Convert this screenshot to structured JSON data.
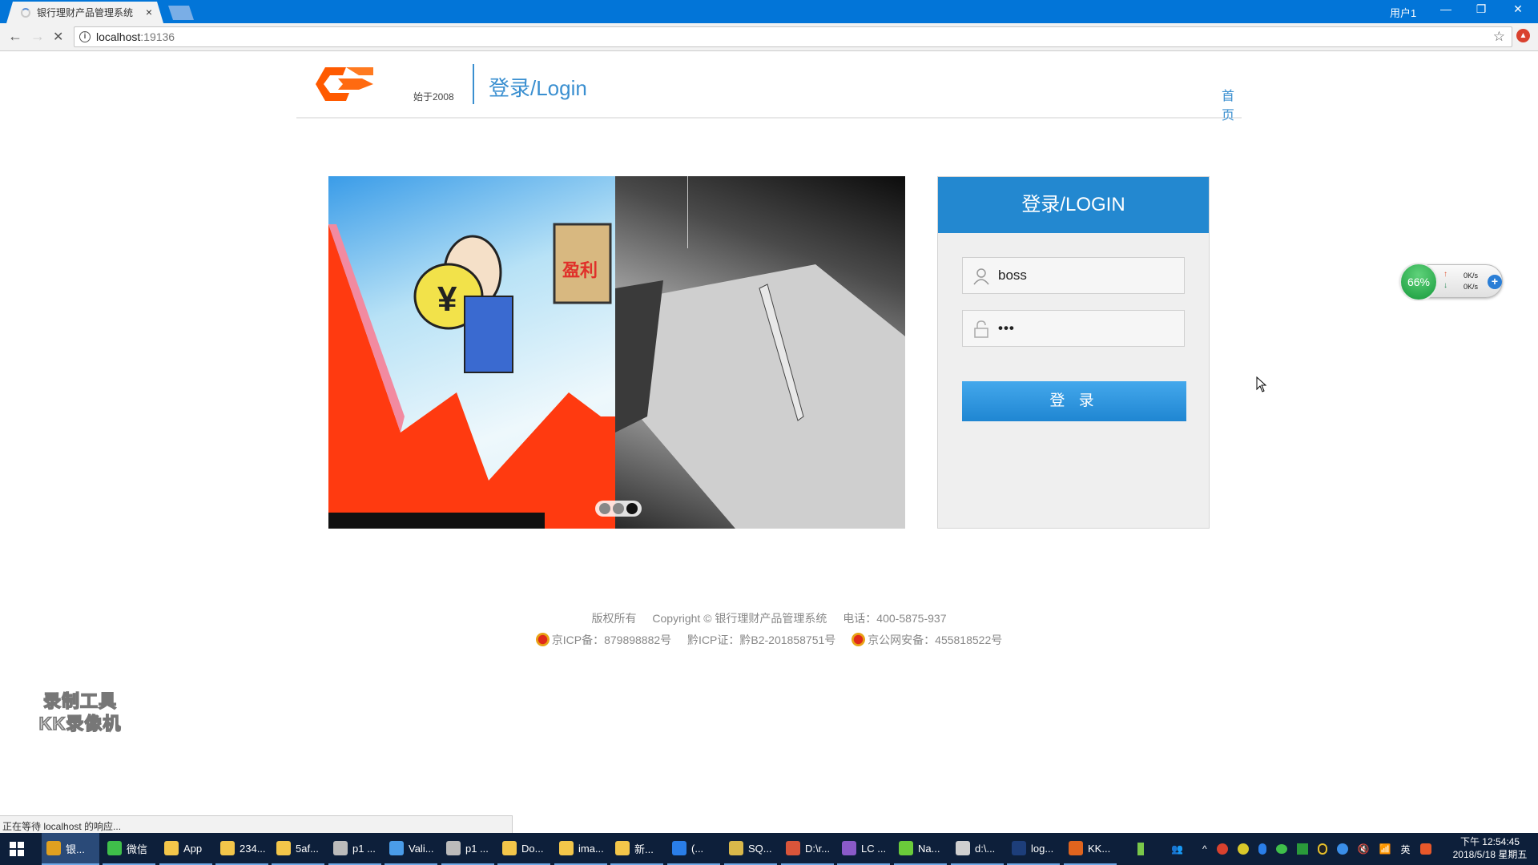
{
  "browser": {
    "tab_title": "银行理财产品管理系统",
    "tab_close": "×",
    "user_label": "用户1",
    "window_controls": {
      "minimize": "—",
      "restore": "❐",
      "close": "✕"
    },
    "nav": {
      "back": "←",
      "forward": "→",
      "stop": "✕"
    },
    "url_host": "localhost",
    "url_port": ":19136",
    "star": "☆",
    "status_text": "正在等待 localhost 的响应..."
  },
  "header": {
    "since": "始于2008",
    "title": "登录/Login",
    "home_link": "首页",
    "brand_color": "#ff5a00",
    "accent_color": "#3a8fd0"
  },
  "carousel": {
    "slide_text": "盈利",
    "slide_count": 3,
    "active_slide": 3
  },
  "login": {
    "heading": "登录/LOGIN",
    "username_icon": "user-icon",
    "username_value": "boss",
    "password_icon": "lock-icon",
    "password_value": "•••",
    "submit_label": "登 录",
    "header_color": "#2388d0"
  },
  "footer": {
    "rights": "版权所有",
    "copyright": "Copyright © 银行理财产品管理系统",
    "phone": "电话：400-5875-937",
    "icp1": "京ICP备：879898882号",
    "icp2": "黔ICP证：黔B2-201858751号",
    "police": "京公网安备：455818522号"
  },
  "netspeed": {
    "percent": "66%",
    "up_arrow": "↑",
    "down_arrow": "↓",
    "up": "0K/s",
    "down": "0K/s",
    "plus": "+"
  },
  "watermark": {
    "line1": "录制工具",
    "line2": "KK录像机"
  },
  "taskbar": {
    "items": [
      {
        "label": "银...",
        "icon": "chrome-icon",
        "color": "#e0a020"
      },
      {
        "label": "微信",
        "icon": "wechat-icon",
        "color": "#3fbf4a"
      },
      {
        "label": "App",
        "icon": "folder-icon",
        "color": "#f3c64a"
      },
      {
        "label": "234...",
        "icon": "folder-icon",
        "color": "#f3c64a"
      },
      {
        "label": "5af...",
        "icon": "folder-icon",
        "color": "#f3c64a"
      },
      {
        "label": "p1 ...",
        "icon": "drive-icon",
        "color": "#bbbbbb"
      },
      {
        "label": "Vali...",
        "icon": "cube-icon",
        "color": "#4a9ce8"
      },
      {
        "label": "p1 ...",
        "icon": "drive-icon",
        "color": "#bbbbbb"
      },
      {
        "label": "Do...",
        "icon": "folder-icon",
        "color": "#f3c64a"
      },
      {
        "label": "ima...",
        "icon": "folder-icon",
        "color": "#f3c64a"
      },
      {
        "label": "新...",
        "icon": "folder-icon",
        "color": "#f3c64a"
      },
      {
        "label": "(...",
        "icon": "wps-icon",
        "color": "#2a7ee8"
      },
      {
        "label": "SQ...",
        "icon": "sql-tools-icon",
        "color": "#d9b84a"
      },
      {
        "label": "D:\\r...",
        "icon": "editor-icon",
        "color": "#d9553a"
      },
      {
        "label": "LC ...",
        "icon": "visual-studio-icon",
        "color": "#8a5ac8"
      },
      {
        "label": "Na...",
        "icon": "navicat-icon",
        "color": "#6acb3a"
      },
      {
        "label": "d:\\...",
        "icon": "console-icon",
        "color": "#cfcfcf"
      },
      {
        "label": "log...",
        "icon": "photoshop-icon",
        "color": "#1d3e7a"
      },
      {
        "label": "KK...",
        "icon": "kk-recorder-icon",
        "color": "#e0641e"
      }
    ],
    "tray": {
      "ime": "英",
      "volume": "🔇",
      "time": "下午 12:54:45",
      "date": "2018/5/18 星期五"
    }
  }
}
